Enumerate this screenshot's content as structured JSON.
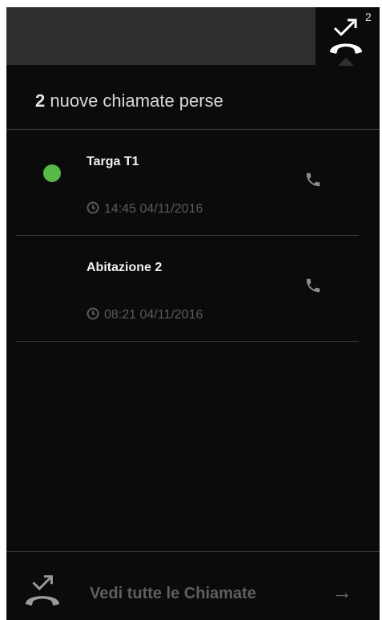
{
  "topbar": {
    "missed_icon": "missed-call-icon",
    "badge_count": "2"
  },
  "header": {
    "count": "2",
    "text": "nuove chiamate perse"
  },
  "calls": [
    {
      "name": "Targa T1",
      "time": "14:45 04/11/2016",
      "status_dot": "online-dot",
      "status_color": "#58b947",
      "call_icon": "phone-icon"
    },
    {
      "name": "Abitazione 2",
      "time": "08:21 04/11/2016",
      "call_icon": "phone-icon"
    }
  ],
  "footer": {
    "icon": "missed-call-icon",
    "label": "Vedi tutte le Chiamate",
    "arrow": "→"
  },
  "colors": {
    "background": "#0b0b0b",
    "topbar": "#2d302f",
    "accent_green": "#58b947",
    "phone_icon": "#8c8c8c"
  }
}
